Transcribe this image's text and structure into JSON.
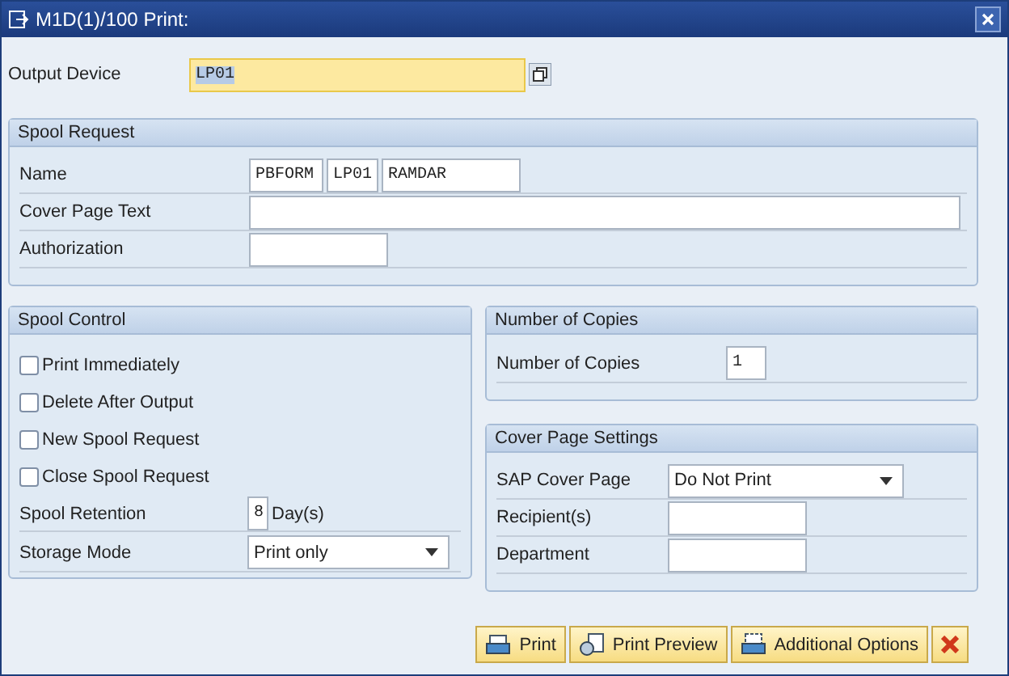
{
  "window": {
    "title": "M1D(1)/100 Print:"
  },
  "output_device": {
    "label": "Output Device",
    "value": "LP01"
  },
  "spool_request": {
    "title": "Spool Request",
    "rows": [
      {
        "label": "Name",
        "fields": [
          "PBFORM",
          "LP01",
          "RAMDAR"
        ]
      },
      {
        "label": "Cover Page Text"
      },
      {
        "label": "Authorization"
      }
    ]
  },
  "spool_control": {
    "title": "Spool Control",
    "checkboxes": [
      {
        "label": "Print Immediately",
        "checked": false
      },
      {
        "label": "Delete After Output",
        "checked": false
      },
      {
        "label": "New Spool Request",
        "checked": false
      },
      {
        "label": "Close Spool Request",
        "checked": false
      }
    ],
    "retention": {
      "label": "Spool Retention",
      "value": "8",
      "unit": "Day(s)"
    },
    "storage_mode": {
      "label": "Storage Mode",
      "value": "Print only"
    }
  },
  "copies": {
    "title": "Number of Copies",
    "label": "Number of Copies",
    "value": "1"
  },
  "cover_page": {
    "title": "Cover Page Settings",
    "rows": [
      {
        "kind": "dropdown",
        "label": "SAP Cover Page",
        "value": "Do Not Print"
      },
      {
        "kind": "input",
        "label": "Recipient(s)"
      },
      {
        "kind": "input",
        "label": "Department"
      }
    ]
  },
  "buttons": [
    {
      "kind": "print",
      "label": "Print"
    },
    {
      "kind": "preview",
      "label": "Print Preview"
    },
    {
      "kind": "options",
      "label": "Additional Options"
    },
    {
      "kind": "cancel"
    }
  ]
}
